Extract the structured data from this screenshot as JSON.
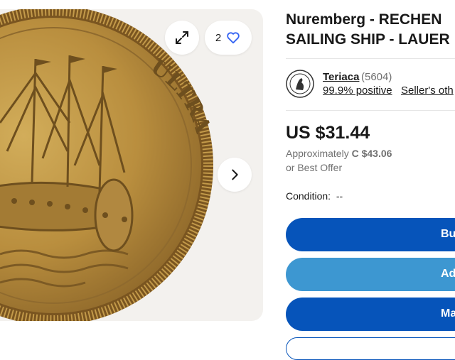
{
  "gallery": {
    "coin_text": "ULTRA",
    "watch_count": "2",
    "icons": {
      "expand": "expand-icon",
      "watch": "heart-icon",
      "next": "chevron-right-icon"
    }
  },
  "listing": {
    "title_line1": "Nuremberg - RECHEN",
    "title_line2": "SAILING SHIP - LAUER"
  },
  "seller": {
    "name": "Teriaca",
    "feedback_count": "(5604)",
    "positive": "99.9% positive",
    "other_link": "Seller's oth"
  },
  "pricing": {
    "price": "US $31.44",
    "approx_label": "Approximately",
    "approx_value": "C $43.06",
    "best_offer": "or Best Offer"
  },
  "condition": {
    "label": "Condition:",
    "value": "--"
  },
  "actions": {
    "buy_label": "Bu",
    "cart_label": "Ad",
    "watch_label": "Ma"
  },
  "colors": {
    "primary_blue": "#0654ba",
    "light_blue": "#3d97d1",
    "heart_blue": "#3665f3",
    "gallery_bg": "#f3f1ee"
  }
}
